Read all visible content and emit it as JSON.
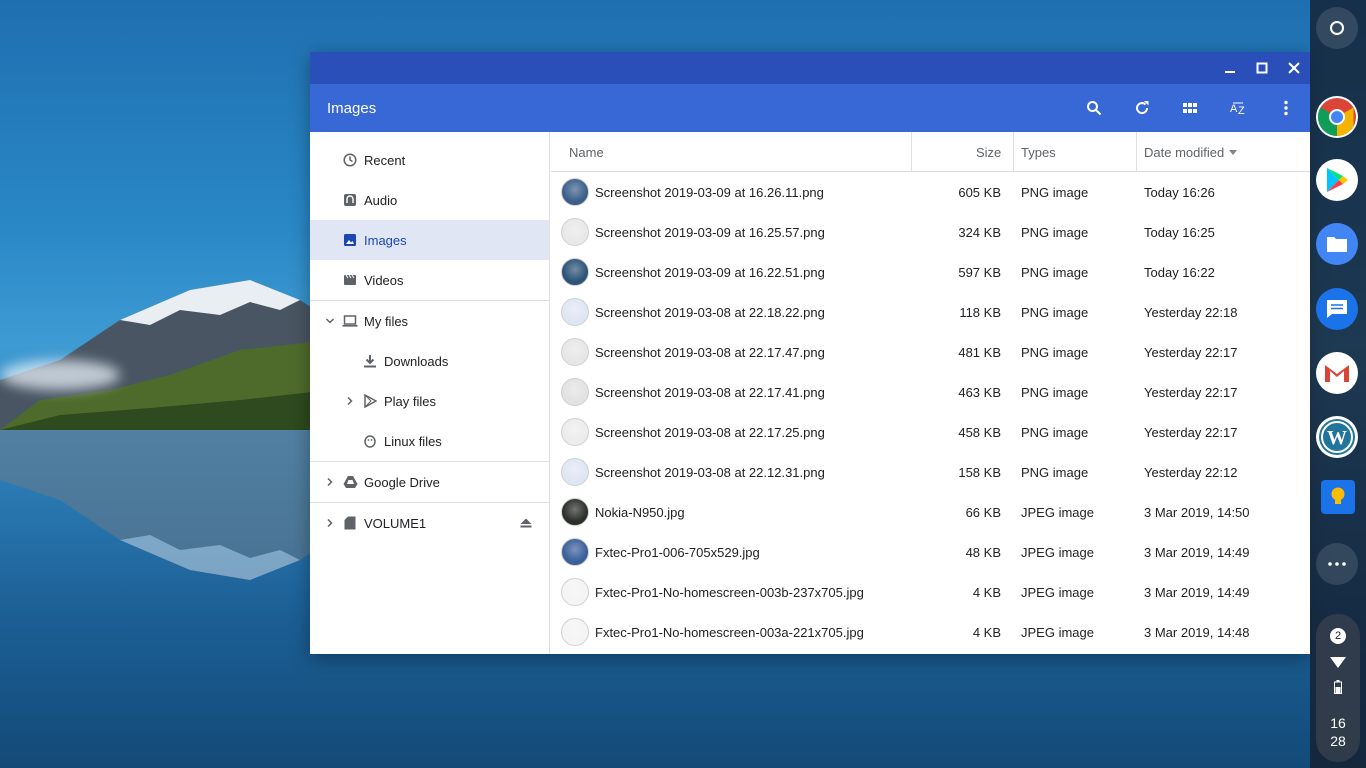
{
  "window": {
    "app_title": "Images",
    "controls": [
      "minimize-icon",
      "maximize-icon",
      "close-icon"
    ]
  },
  "toolbar": {
    "icons": [
      "search-icon",
      "refresh-icon",
      "grid-view-icon",
      "sort-az-icon",
      "more-vert-icon"
    ]
  },
  "sidebar": {
    "items": [
      {
        "label": "Recent",
        "icon": "clock-icon"
      },
      {
        "label": "Audio",
        "icon": "audio-icon"
      },
      {
        "label": "Images",
        "icon": "image-icon",
        "selected": true
      },
      {
        "label": "Videos",
        "icon": "video-icon"
      },
      {
        "label": "My files",
        "icon": "laptop-icon"
      },
      {
        "label": "Downloads",
        "icon": "download-icon"
      },
      {
        "label": "Play files",
        "icon": "play-icon"
      },
      {
        "label": "Linux files",
        "icon": "penguin-icon"
      },
      {
        "label": "Google Drive",
        "icon": "drive-icon"
      },
      {
        "label": "VOLUME1",
        "icon": "sd-card-icon"
      }
    ]
  },
  "table": {
    "headers": {
      "name": "Name",
      "size": "Size",
      "type": "Types",
      "date": "Date modified"
    },
    "rows": [
      {
        "name": "Screenshot 2019-03-09 at 16.26.11.png",
        "size": "605 KB",
        "type": "PNG image",
        "date": "Today 16:26",
        "thumb": "#3b5f8a"
      },
      {
        "name": "Screenshot 2019-03-09 at 16.25.57.png",
        "size": "324 KB",
        "type": "PNG image",
        "date": "Today 16:25",
        "thumb": "#e8e8e8"
      },
      {
        "name": "Screenshot 2019-03-09 at 16.22.51.png",
        "size": "597 KB",
        "type": "PNG image",
        "date": "Today 16:22",
        "thumb": "#2c5478"
      },
      {
        "name": "Screenshot 2019-03-08 at 22.18.22.png",
        "size": "118 KB",
        "type": "PNG image",
        "date": "Yesterday 22:18",
        "thumb": "#dfe6f3"
      },
      {
        "name": "Screenshot 2019-03-08 at 22.17.47.png",
        "size": "481 KB",
        "type": "PNG image",
        "date": "Yesterday 22:17",
        "thumb": "#e6e6e6"
      },
      {
        "name": "Screenshot 2019-03-08 at 22.17.41.png",
        "size": "463 KB",
        "type": "PNG image",
        "date": "Yesterday 22:17",
        "thumb": "#e2e2e2"
      },
      {
        "name": "Screenshot 2019-03-08 at 22.17.25.png",
        "size": "458 KB",
        "type": "PNG image",
        "date": "Yesterday 22:17",
        "thumb": "#ececec"
      },
      {
        "name": "Screenshot 2019-03-08 at 22.12.31.png",
        "size": "158 KB",
        "type": "PNG image",
        "date": "Yesterday 22:12",
        "thumb": "#dfe6f3"
      },
      {
        "name": "Nokia-N950.jpg",
        "size": "66 KB",
        "type": "JPEG image",
        "date": "3 Mar 2019, 14:50",
        "thumb": "#2b2f2a"
      },
      {
        "name": "Fxtec-Pro1-006-705x529.jpg",
        "size": "48 KB",
        "type": "JPEG image",
        "date": "3 Mar 2019, 14:49",
        "thumb": "#3a5f9a"
      },
      {
        "name": "Fxtec-Pro1-No-homescreen-003b-237x705.jpg",
        "size": "4 KB",
        "type": "JPEG image",
        "date": "3 Mar 2019, 14:49",
        "thumb": "#f4f4f4"
      },
      {
        "name": "Fxtec-Pro1-No-homescreen-003a-221x705.jpg",
        "size": "4 KB",
        "type": "JPEG image",
        "date": "3 Mar 2019, 14:48",
        "thumb": "#f4f4f4"
      }
    ]
  },
  "shelf": {
    "apps": [
      "launcher-icon",
      "chrome-icon",
      "play-store-icon",
      "files-icon",
      "messages-icon",
      "gmail-icon",
      "wordpress-icon",
      "keep-icon",
      "more-apps-icon"
    ],
    "notification_count": "2",
    "clock_hour": "16",
    "clock_minute": "28"
  },
  "colors": {
    "titlebar": "#2a4fb8",
    "appbar": "#3867d6",
    "selected_bg": "#e1e6f5",
    "selected_text": "#1a47b3"
  }
}
